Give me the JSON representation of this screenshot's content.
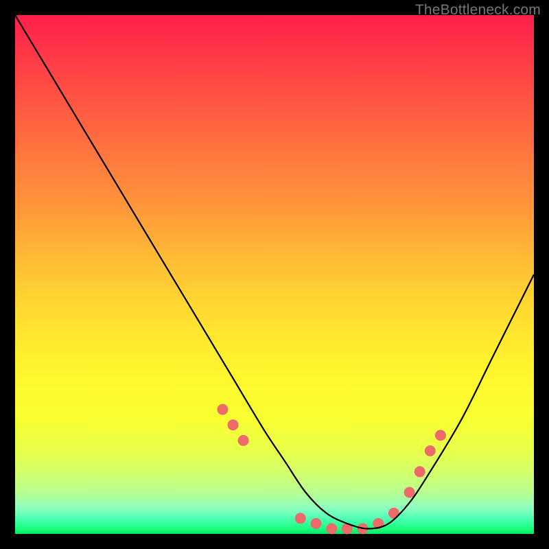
{
  "watermark": "TheBottleneck.com",
  "chart_data": {
    "type": "line",
    "title": "",
    "xlabel": "",
    "ylabel": "",
    "xlim": [
      0,
      100
    ],
    "ylim": [
      0,
      100
    ],
    "series": [
      {
        "name": "bottleneck-curve",
        "x": [
          0,
          6,
          12,
          18,
          24,
          30,
          36,
          42,
          48,
          52,
          56,
          60,
          64,
          68,
          72,
          76,
          80,
          86,
          92,
          98,
          100
        ],
        "y": [
          100,
          90,
          80,
          70,
          60,
          50,
          40,
          30,
          20,
          14,
          8,
          4,
          2,
          1,
          2,
          6,
          12,
          22,
          34,
          46,
          50
        ]
      }
    ],
    "markers": {
      "name": "highlight-dots",
      "x": [
        40,
        42,
        44,
        55,
        58,
        61,
        64,
        67,
        70,
        73,
        76,
        78,
        80,
        82
      ],
      "y": [
        24,
        21,
        18,
        3,
        2,
        1,
        1,
        1,
        2,
        4,
        8,
        12,
        16,
        19
      ],
      "color": "#ec6a6a",
      "radius": 8
    },
    "colors": {
      "curve": "#000000",
      "background_top": "#ff1f4a",
      "background_bottom": "#00e862",
      "frame": "#000000"
    }
  }
}
